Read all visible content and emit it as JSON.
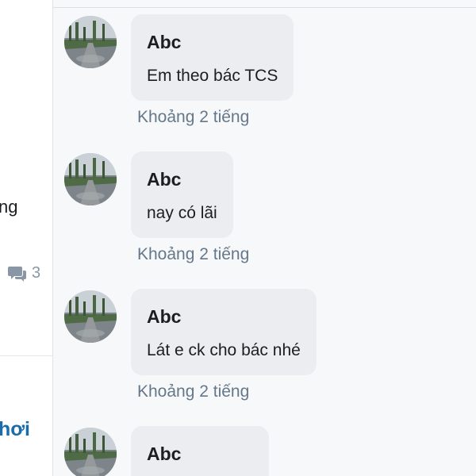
{
  "left_feed": {
    "partial_text": "ng",
    "comment_count": "3",
    "partial_link": "hơi"
  },
  "comments": [
    {
      "author": "Abc",
      "text": "Em theo bác TCS",
      "time": "Khoảng 2 tiếng"
    },
    {
      "author": "Abc",
      "text": "nay có lãi",
      "time": "Khoảng 2 tiếng"
    },
    {
      "author": "Abc",
      "text": "Lát e ck cho bác nhé",
      "time": "Khoảng 2 tiếng"
    },
    {
      "author": "Abc",
      "text": "",
      "time": ""
    }
  ],
  "icons": {
    "comment_icon": "comment-bubbles-icon",
    "avatar": "road-landscape-avatar"
  },
  "colors": {
    "bubble_bg": "#ebedf0",
    "panel_bg": "#f7f8fa",
    "time_text": "#65788a",
    "link": "#1b6cab"
  }
}
